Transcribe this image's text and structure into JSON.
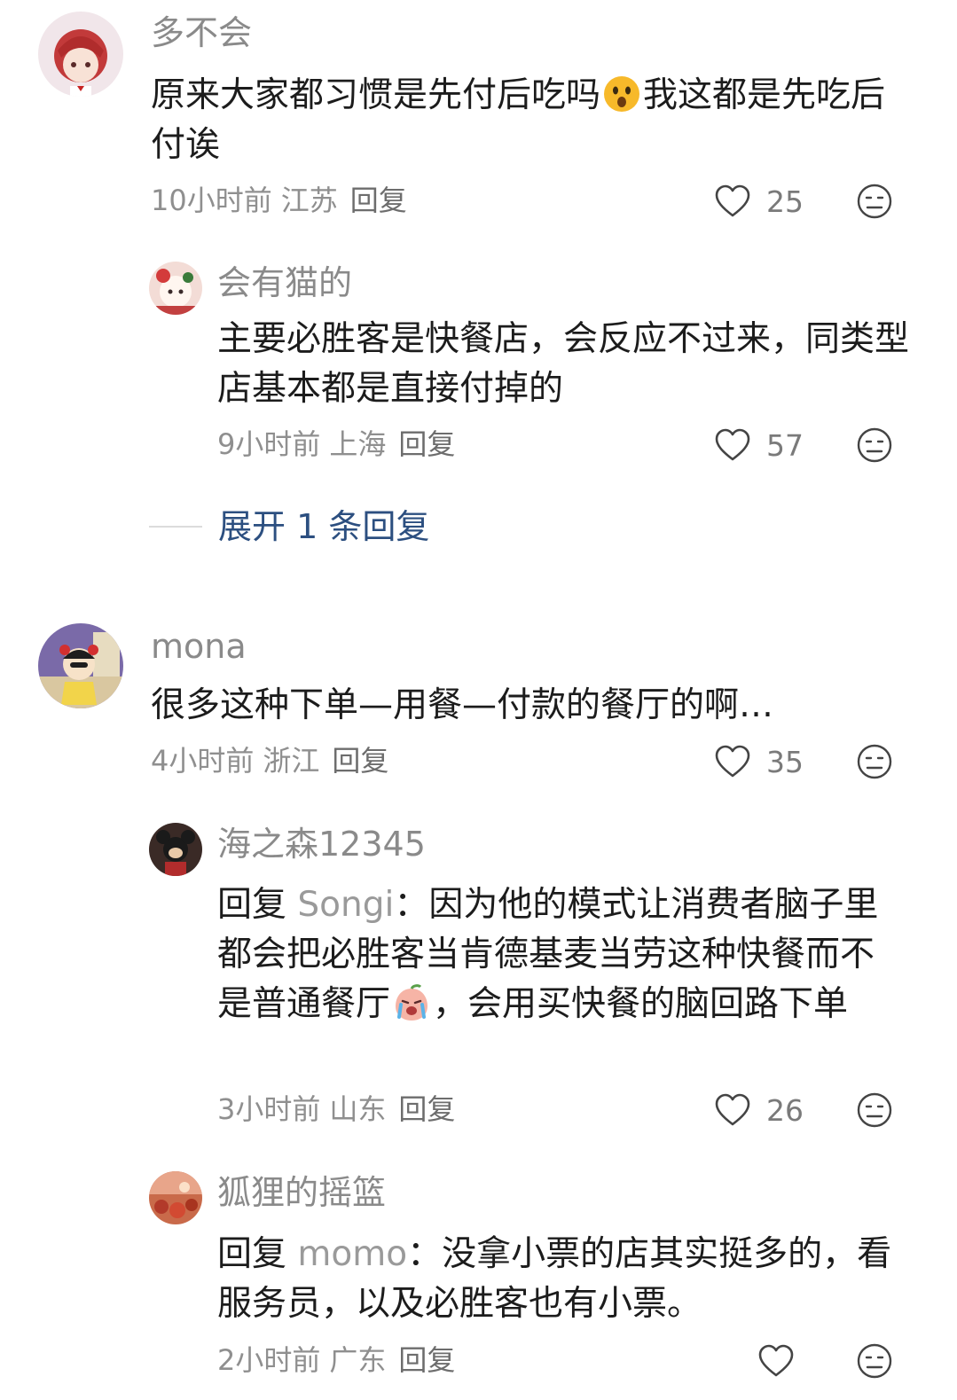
{
  "comments": [
    {
      "username": "多不会",
      "text_before": "原来大家都习惯是先付后吃吗",
      "text_after": "我这都是先吃后付诶",
      "emoji": "astonished-face",
      "time": "10小时前",
      "location": "江苏",
      "reply_label": "回复",
      "likes": "25"
    },
    {
      "username": "会有猫的",
      "text": "主要必胜客是快餐店，会反应不过来，同类型店基本都是直接付掉的",
      "time": "9小时前",
      "location": "上海",
      "reply_label": "回复",
      "likes": "57"
    },
    {
      "username": "mona",
      "text": "很多这种下单—用餐—付款的餐厅的啊…",
      "time": "4小时前",
      "location": "浙江",
      "reply_label": "回复",
      "likes": "35"
    },
    {
      "username": "海之森12345",
      "reply_prefix": "回复",
      "mention": "Songi",
      "colon": "：",
      "text_before": "因为他的模式让消费者脑子里都会把必胜客当肯德基麦当劳这种快餐而不是普通餐厅",
      "text_after": "，会用买快餐的脑回路下单",
      "emoji": "crying-peach",
      "time": "3小时前",
      "location": "山东",
      "reply_label": "回复",
      "likes": "26"
    },
    {
      "username": "狐狸的摇篮",
      "reply_prefix": "回复",
      "mention": "momo",
      "colon": "：",
      "text": "没拿小票的店其实挺多的，看服务员，以及必胜客也有小票。",
      "time": "2小时前",
      "location": "广东",
      "reply_label": "回复",
      "likes": ""
    }
  ],
  "expand_replies": "展开 1 条回复",
  "icons": {
    "like": "heart-outline-icon",
    "dislike": "neutral-face-icon"
  },
  "colors": {
    "link": "#2c4f80",
    "meta": "#8f8f8f",
    "text": "#1c1c1c"
  }
}
